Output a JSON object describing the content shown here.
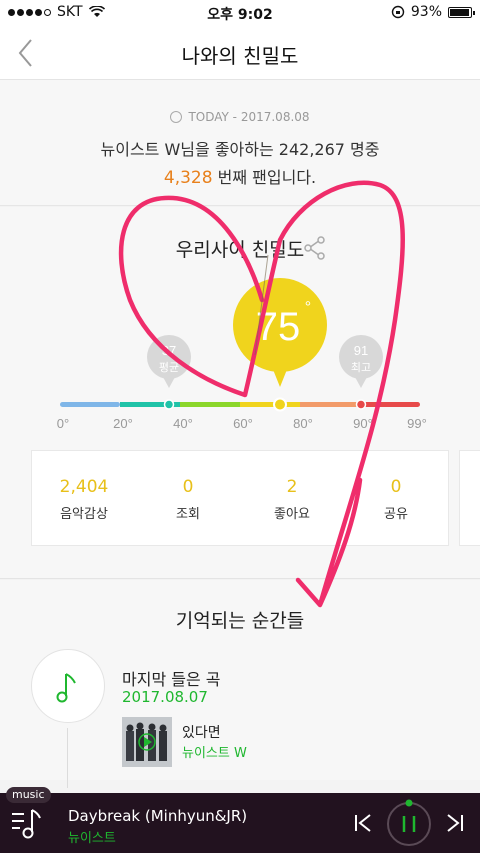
{
  "status_bar": {
    "carrier": "SKT",
    "time": "오후 9:02",
    "battery": "93%"
  },
  "nav": {
    "title": "나와의 친밀도",
    "back_icon": "chevron-left-icon"
  },
  "today": {
    "date": "TODAY - 2017.08.08",
    "line1": "뉴이스트 W님을 좋아하는 242,267 명중",
    "rank": "4,328",
    "line2_suffix": " 번째 팬입니다."
  },
  "intimacy": {
    "heading": "우리사이 친밀도",
    "current": "75",
    "degree_symbol": "°",
    "average": {
      "value": "37",
      "label": "평균"
    },
    "best": {
      "value": "91",
      "label": "최고"
    },
    "ticks": [
      "0°",
      "20°",
      "40°",
      "60°",
      "80°",
      "90°",
      "99°"
    ],
    "scale_colors": [
      "#7fb6e8",
      "#20c3a8",
      "#8bd62a",
      "#f0d41d",
      "#f29b6a",
      "#e74a4a"
    ]
  },
  "stats": [
    {
      "value": "2,404",
      "label": "음악감상"
    },
    {
      "value": "0",
      "label": "조회"
    },
    {
      "value": "2",
      "label": "좋아요"
    },
    {
      "value": "0",
      "label": "공유"
    }
  ],
  "memories": {
    "heading": "기억되는 순간들",
    "item_title": "마지막 들은 곡",
    "item_date": "2017.08.07",
    "song_title": "있다면",
    "song_artist": "뉴이스트 W"
  },
  "player": {
    "badge": "music",
    "title": "Daybreak (Minhyun&JR)",
    "artist": "뉴이스트"
  },
  "colors": {
    "accent_green": "#1fb72f",
    "accent_yellow": "#f0d41d",
    "rank_orange": "#e8801b",
    "scribble": "#ef2d6b"
  }
}
